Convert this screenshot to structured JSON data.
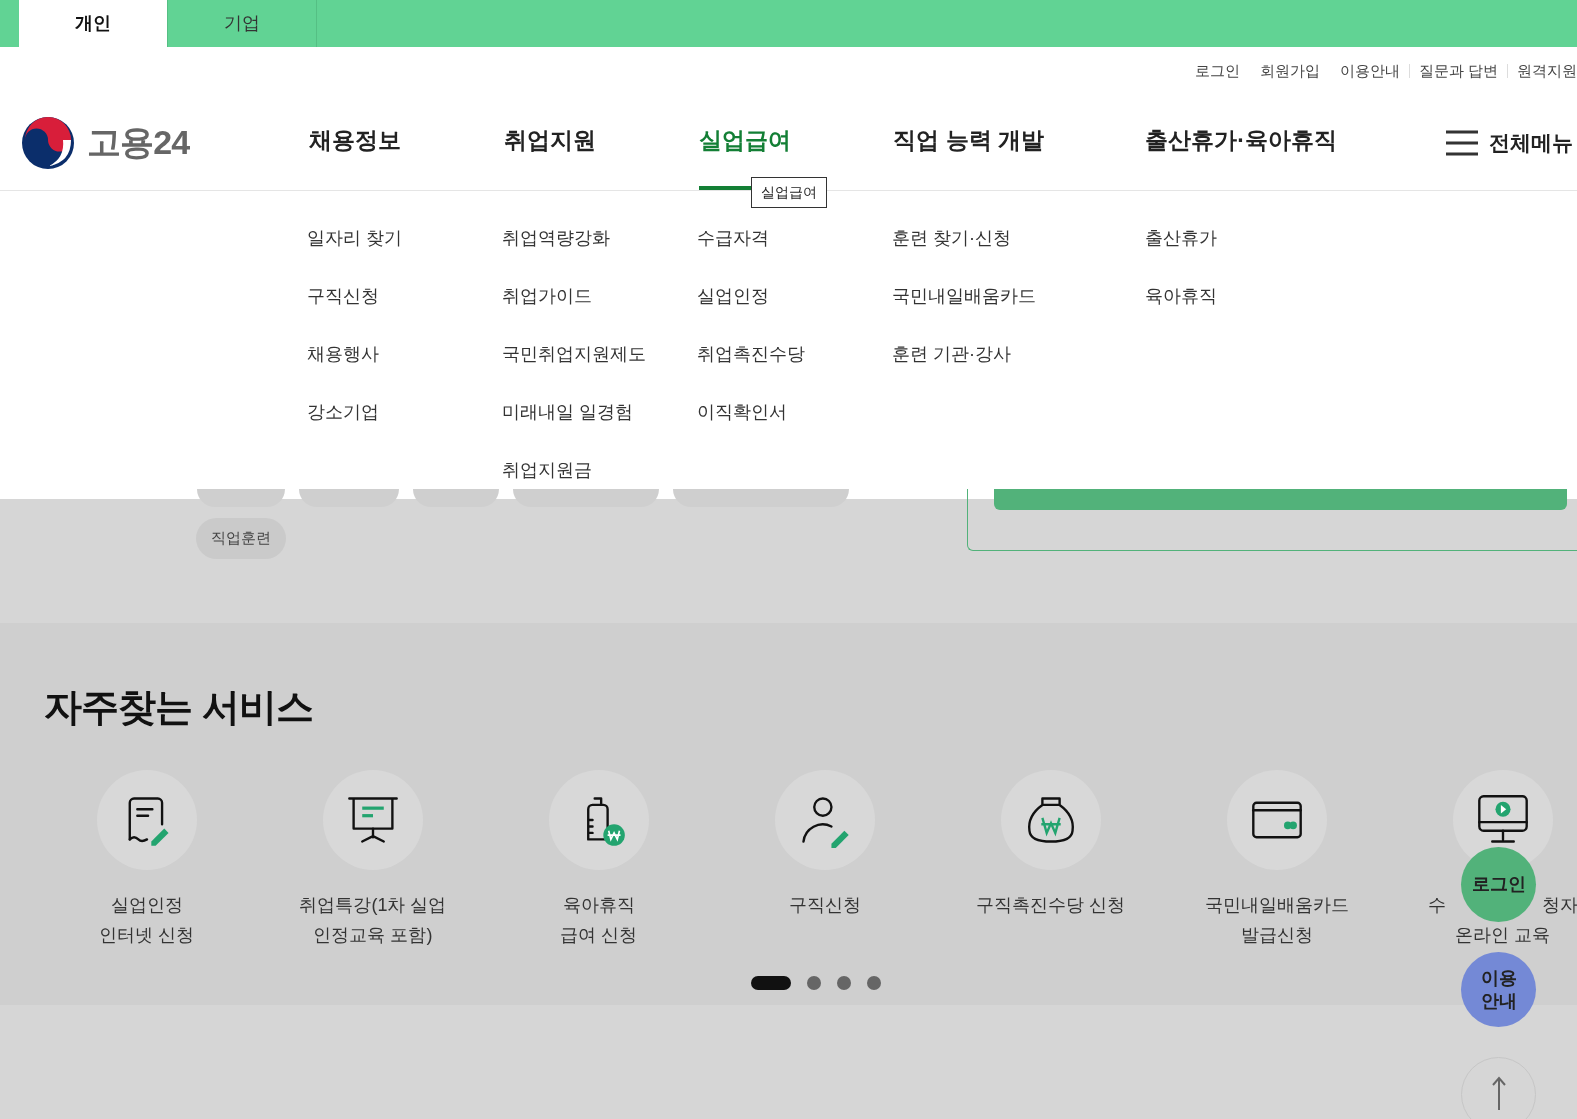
{
  "audience_tabs": [
    {
      "label": "개인",
      "selected": true
    },
    {
      "label": "기업",
      "selected": false
    }
  ],
  "utility_links": [
    "로그인",
    "회원가입",
    "이용안내",
    "질문과 답변",
    "원격지원"
  ],
  "logo": {
    "text": "고용24"
  },
  "nav": [
    {
      "label": "채용정보",
      "selected": false,
      "items": [
        "일자리 찾기",
        "구직신청",
        "채용행사",
        "강소기업"
      ]
    },
    {
      "label": "취업지원",
      "selected": false,
      "items": [
        "취업역량강화",
        "취업가이드",
        "국민취업지원제도",
        "미래내일 일경험",
        "취업지원금"
      ]
    },
    {
      "label": "실업급여",
      "selected": true,
      "items": [
        "수급자격",
        "실업인정",
        "취업촉진수당",
        "이직확인서"
      ]
    },
    {
      "label": "직업 능력 개발",
      "selected": false,
      "items": [
        "훈련 찾기·신청",
        "국민내일배움카드",
        "훈련 기관·강사"
      ]
    },
    {
      "label": "출산휴가·육아휴직",
      "selected": false,
      "items": [
        "출산휴가",
        "육아휴직"
      ]
    }
  ],
  "all_menu": {
    "label": "전체메뉴"
  },
  "tooltip": "실업급여",
  "keyword_chips": [
    "직업훈련"
  ],
  "services": {
    "title": "자주찾는 서비스",
    "items": [
      {
        "kind": "document",
        "lines": [
          "실업인정",
          "인터넷 신청"
        ]
      },
      {
        "kind": "presentation",
        "lines": [
          "취업특강(1차 실업",
          "인정교육 포함)"
        ]
      },
      {
        "kind": "bottle",
        "lines": [
          "육아휴직",
          "급여 신청"
        ]
      },
      {
        "kind": "person",
        "lines": [
          "구직신청"
        ]
      },
      {
        "kind": "moneybag",
        "lines": [
          "구직촉진수당 신청"
        ]
      },
      {
        "kind": "card",
        "lines": [
          "국민내일배움카드",
          "발급신청"
        ]
      },
      {
        "kind": "monitor",
        "lines": [
          [
            "수",
            "청자"
          ],
          "온라인 교육"
        ]
      }
    ],
    "pages": [
      {
        "selected": true
      },
      {
        "selected": false
      },
      {
        "selected": false
      },
      {
        "selected": false
      }
    ]
  },
  "floating": {
    "login": "로그인",
    "guide": [
      "이용",
      "안내"
    ]
  }
}
